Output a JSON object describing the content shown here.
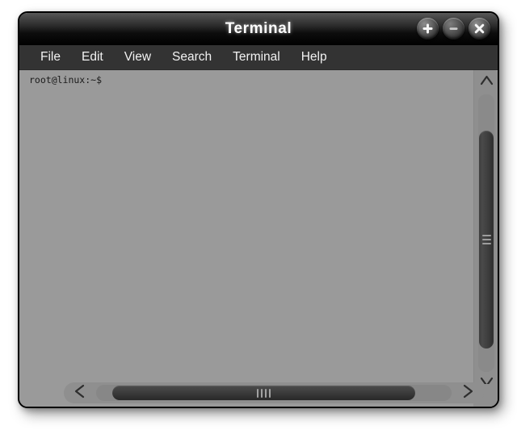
{
  "window": {
    "title": "Terminal",
    "controls": [
      {
        "name": "maximize-button",
        "glyph": "+",
        "label": "Maximize"
      },
      {
        "name": "minimize-button",
        "glyph": "−",
        "label": "Minimize"
      },
      {
        "name": "close-button",
        "glyph": "×",
        "label": "Close"
      }
    ]
  },
  "menubar": {
    "items": [
      {
        "label": "File"
      },
      {
        "label": "Edit"
      },
      {
        "label": "View"
      },
      {
        "label": "Search"
      },
      {
        "label": "Terminal"
      },
      {
        "label": "Help"
      }
    ]
  },
  "terminal": {
    "prompt": "root@linux:~$",
    "lines": [
      "root@linux:~$"
    ],
    "user": "root",
    "host": "linux",
    "cwd": "~",
    "symbol": "$",
    "background_color": "#9a9a9a",
    "text_color": "#1a1a1a"
  },
  "scrollbars": {
    "vertical": {
      "up_arrow_icon": "chevron-up-icon",
      "down_arrow_icon": "chevron-down-icon",
      "grip_count": 3,
      "thumb_position_percent": 13,
      "thumb_size_percent": 79
    },
    "horizontal": {
      "left_arrow_icon": "chevron-left-icon",
      "right_arrow_icon": "chevron-right-icon",
      "grip_count": 4,
      "thumb_position_percent": 5,
      "thumb_size_percent": 87
    }
  },
  "theme": {
    "titlebar_top": "#585858",
    "titlebar_bottom": "#000000",
    "menubar": "#333333",
    "content": "#9a9a9a",
    "trough": "#8f8f8f",
    "thumb": "#3c3c3c",
    "text_light": "#f2f2f2",
    "border": "#000000"
  }
}
